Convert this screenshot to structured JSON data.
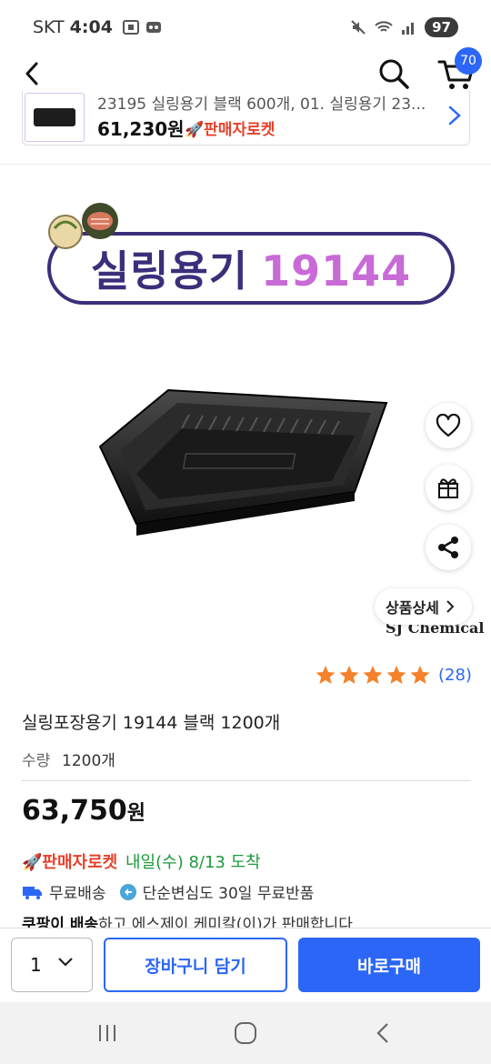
{
  "status_bar": {
    "carrier": "SKT",
    "time": "4:04",
    "battery": "97"
  },
  "header": {
    "cart_count": "70"
  },
  "option_strip": {
    "title": "23195 실링용기 블랙 600개, 01. 실링용기 23...",
    "price": "61,230원",
    "rocket_label": "🚀판매자로켓"
  },
  "product_image": {
    "banner_korean": "실링용기",
    "banner_number": "19144",
    "brand_mark": "SJ Chemical",
    "detail_button": "상품상세"
  },
  "rating": {
    "stars": 5,
    "review_count": "(28)"
  },
  "product": {
    "title": "실링포장용기 19144 블랙 1200개",
    "qty_label": "수량",
    "qty_value": "1200개",
    "price_number": "63,750",
    "price_unit": "원",
    "rocket_label": "🚀판매자로켓",
    "arrival": "내일(수) 8/13 도착",
    "free_shipping": "무료배송",
    "free_return": "단순변심도 30일 무료반품",
    "seller_bold": "쿠팡이 배송",
    "seller_rest": "하고 에스제이 케미칼(이)가 판매합니다"
  },
  "bottom_bar": {
    "quantity": "1",
    "add_to_cart": "장바구니 담기",
    "buy_now": "바로구매"
  },
  "colors": {
    "accent_blue": "#2b66f6",
    "rocket_red": "#e8402a",
    "arrival_green": "#1d9a3a",
    "star_orange": "#f5822a"
  }
}
